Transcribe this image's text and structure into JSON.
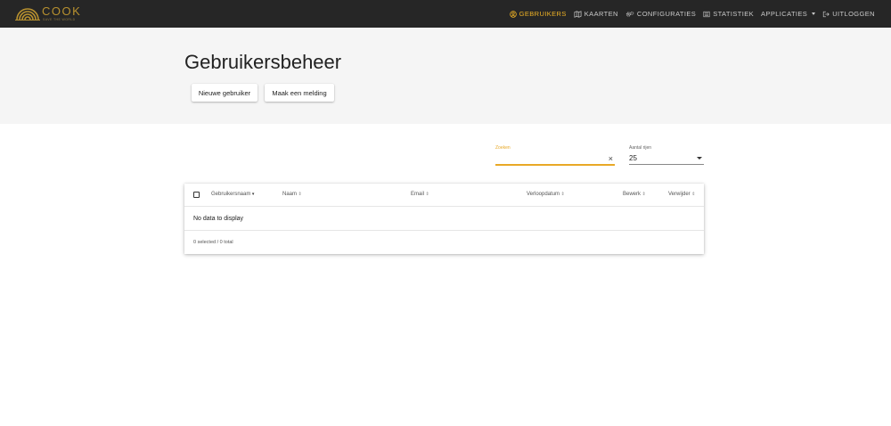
{
  "brand": {
    "name": "COOK",
    "tagline": "SAVE THE WORLD"
  },
  "nav": {
    "items": [
      {
        "label": "GEBRUIKERS",
        "icon": "user-circle-icon",
        "active": true
      },
      {
        "label": "KAARTEN",
        "icon": "map-icon",
        "active": false
      },
      {
        "label": "CONFIGURATIES",
        "icon": "cogs-icon",
        "active": false
      },
      {
        "label": "STATISTIEK",
        "icon": "list-icon",
        "active": false
      },
      {
        "label": "APPLICATIES",
        "icon": "caret-down-icon",
        "active": false
      },
      {
        "label": "UITLOGGEN",
        "icon": "sign-out-icon",
        "active": false
      }
    ]
  },
  "page": {
    "title": "Gebruikersbeheer",
    "new_user_button": "Nieuwe gebruiker",
    "report_button": "Maak een melding"
  },
  "search": {
    "label": "Zoeken",
    "value": "",
    "clear_icon": "×"
  },
  "rows": {
    "label": "Aantal rijen",
    "value": "25"
  },
  "table": {
    "columns": [
      {
        "label": "Gebruikersnaam",
        "sort": "▾"
      },
      {
        "label": "Naam",
        "sort": "⇕"
      },
      {
        "label": "Email",
        "sort": "⇕"
      },
      {
        "label": "Verloopdatum",
        "sort": "⇕"
      },
      {
        "label": "Bewerk",
        "sort": "⇕"
      },
      {
        "label": "Verwijder",
        "sort": "⇕"
      }
    ],
    "empty_message": "No data to display",
    "footer": "0 selected / 0 total"
  },
  "colors": {
    "accent": "#f0b325",
    "navbar": "#262626",
    "header_band": "#f5f5f5"
  }
}
